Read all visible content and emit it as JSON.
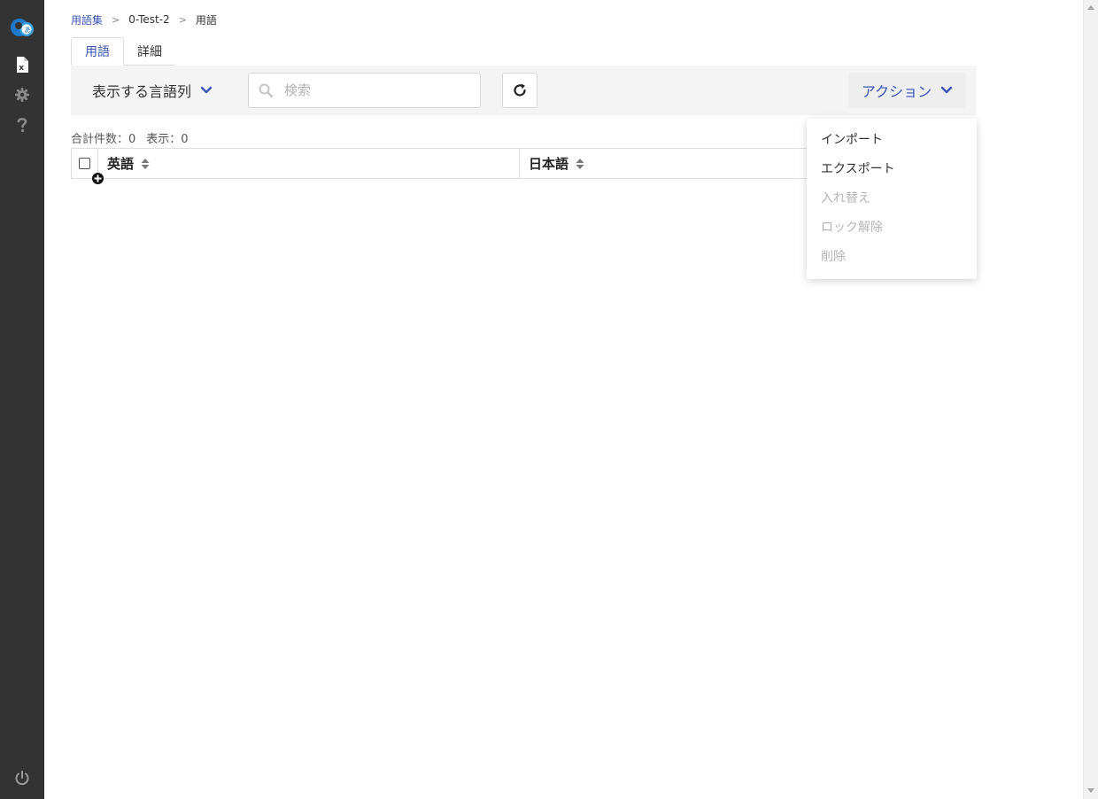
{
  "breadcrumb": {
    "root": "用語集",
    "separator_1": ">",
    "project": "0-Test-2",
    "separator_2": ">",
    "current": "用語"
  },
  "tabs": [
    {
      "label": "用語",
      "active": true
    },
    {
      "label": "詳細",
      "active": false
    }
  ],
  "toolbar": {
    "language_columns_label": "表示する言語列",
    "search_placeholder": "検索",
    "action_label": "アクション"
  },
  "counts": {
    "total": "合計件数：0",
    "shown": "表示：0"
  },
  "table": {
    "columns": [
      {
        "label": "英語"
      },
      {
        "label": "日本語"
      }
    ]
  },
  "action_menu": {
    "items": [
      {
        "label": "インポート",
        "enabled": true
      },
      {
        "label": "エクスポート",
        "enabled": true
      },
      {
        "label": "入れ替え",
        "enabled": false
      },
      {
        "label": "ロック解除",
        "enabled": false
      },
      {
        "label": "削除",
        "enabled": false
      }
    ]
  },
  "colors": {
    "accent": "#3a54b4",
    "rail": "#333333",
    "toolbar_bg": "#f4f4f4",
    "disabled_text": "#b5b5b5"
  },
  "icons": {
    "logo": "app-logo-icon",
    "nav": [
      "excel-file-icon",
      "gear-icon",
      "question-icon"
    ],
    "power": "power-icon",
    "search": "search-icon",
    "refresh": "refresh-icon",
    "sort": "sort-icon",
    "add": "plus-circle-icon",
    "chevron": "chevron-down-icon"
  }
}
